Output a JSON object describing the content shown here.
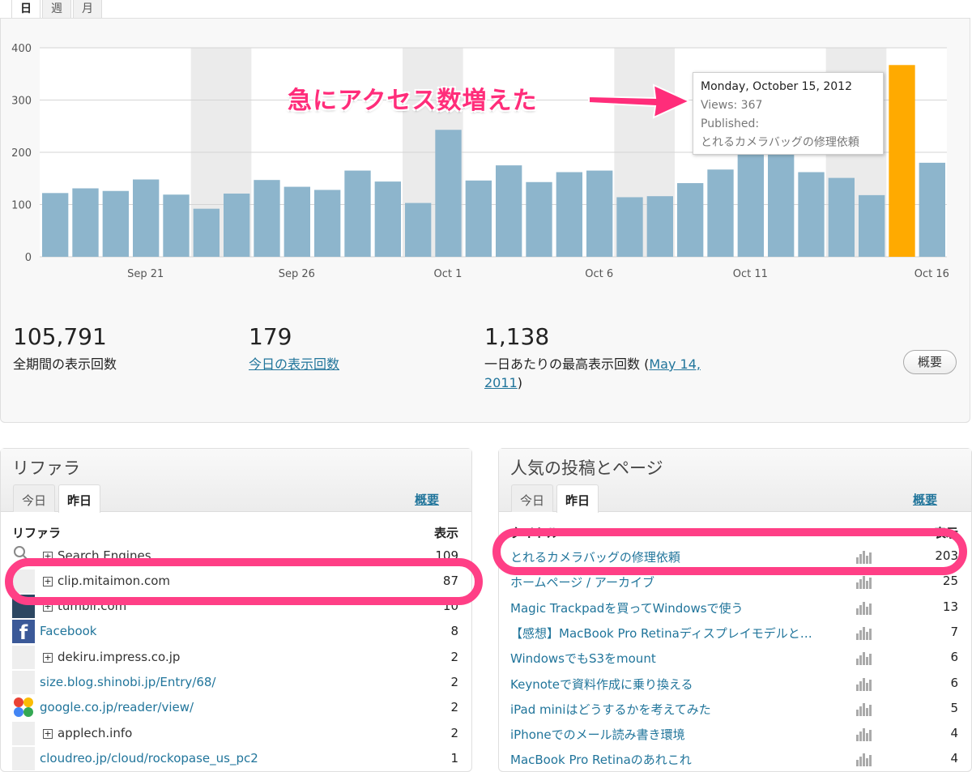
{
  "period_tabs": [
    "日",
    "週",
    "月"
  ],
  "chart_data": {
    "type": "bar",
    "x_ticks": [
      "Sep 21",
      "Sep 26",
      "Oct 1",
      "Oct 6",
      "Oct 11",
      "Oct 16"
    ],
    "y_ticks": [
      "0",
      "100",
      "200",
      "300",
      "400"
    ],
    "ylim": [
      0,
      400
    ],
    "dates": [
      "Sep 18",
      "Sep 19",
      "Sep 20",
      "Sep 21",
      "Sep 22",
      "Sep 23",
      "Sep 24",
      "Sep 25",
      "Sep 26",
      "Sep 27",
      "Sep 28",
      "Sep 29",
      "Sep 30",
      "Oct 1",
      "Oct 2",
      "Oct 3",
      "Oct 4",
      "Oct 5",
      "Oct 6",
      "Oct 7",
      "Oct 8",
      "Oct 9",
      "Oct 10",
      "Oct 11",
      "Oct 12",
      "Oct 13",
      "Oct 14",
      "Oct 15",
      "Oct 16"
    ],
    "values": [
      122,
      131,
      126,
      148,
      119,
      92,
      121,
      147,
      134,
      128,
      165,
      144,
      103,
      243,
      146,
      175,
      143,
      162,
      165,
      114,
      116,
      141,
      167,
      197,
      210,
      162,
      151,
      118,
      367,
      180
    ],
    "highlight_index": 28,
    "bar_color": "#8db5cc",
    "highlight_color": "#ffaa00",
    "weekend_shading": true
  },
  "tooltip": {
    "date": "Monday, October 15, 2012",
    "views": "Views: 367",
    "published_label": "Published:",
    "post": "とれるカメラバッグの修理依頼"
  },
  "annotation": "急にアクセス数増えた",
  "stats": {
    "total_num": "105,791",
    "total_label": "全期間の表示回数",
    "today_num": "179",
    "today_label": "今日の表示回数",
    "best_num": "1,138",
    "best_label": "一日あたりの最高表示回数 (",
    "best_date_1": "May 14,",
    "best_date_2": "2011",
    "best_close": ")",
    "overview_button": "概要"
  },
  "referrers": {
    "title": "リファラ",
    "tab_today": "今日",
    "tab_yesterday": "昨日",
    "summary_link": "概要",
    "col_name": "リファラ",
    "col_views": "表示",
    "rows": [
      {
        "name": "Search Engines",
        "count": "109"
      },
      {
        "name": "clip.mitaimon.com",
        "count": "87"
      },
      {
        "name": "tumblr.com",
        "count": "10"
      },
      {
        "name": "Facebook",
        "count": "8"
      },
      {
        "name": "dekiru.impress.co.jp",
        "count": "2"
      },
      {
        "name": "size.blog.shinobi.jp/Entry/68/",
        "count": "2"
      },
      {
        "name": "google.co.jp/reader/view/",
        "count": "2"
      },
      {
        "name": "applech.info",
        "count": "2"
      },
      {
        "name": "cloudreo.jp/cloud/rockopase_us_pc2",
        "count": "1"
      }
    ]
  },
  "popular": {
    "title": "人気の投稿とページ",
    "tab_today": "今日",
    "tab_yesterday": "昨日",
    "summary_link": "概要",
    "col_name": "タイトル",
    "col_views": "表示",
    "rows": [
      {
        "name": "とれるカメラバッグの修理依頼",
        "count": "203"
      },
      {
        "name": "ホームページ / アーカイブ",
        "count": "25"
      },
      {
        "name": "Magic Trackpadを買ってWindowsで使う",
        "count": "13"
      },
      {
        "name": "【感想】MacBook Pro Retinaディスプレイモデルと…",
        "count": "7"
      },
      {
        "name": "WindowsでもS3をmount",
        "count": "6"
      },
      {
        "name": "Keynoteで資料作成に乗り換える",
        "count": "6"
      },
      {
        "name": "iPad miniはどうするかを考えてみた",
        "count": "5"
      },
      {
        "name": "iPhoneでのメール読み書き環境",
        "count": "4"
      },
      {
        "name": "MacBook Pro Retinaのあれこれ",
        "count": "4"
      }
    ]
  }
}
